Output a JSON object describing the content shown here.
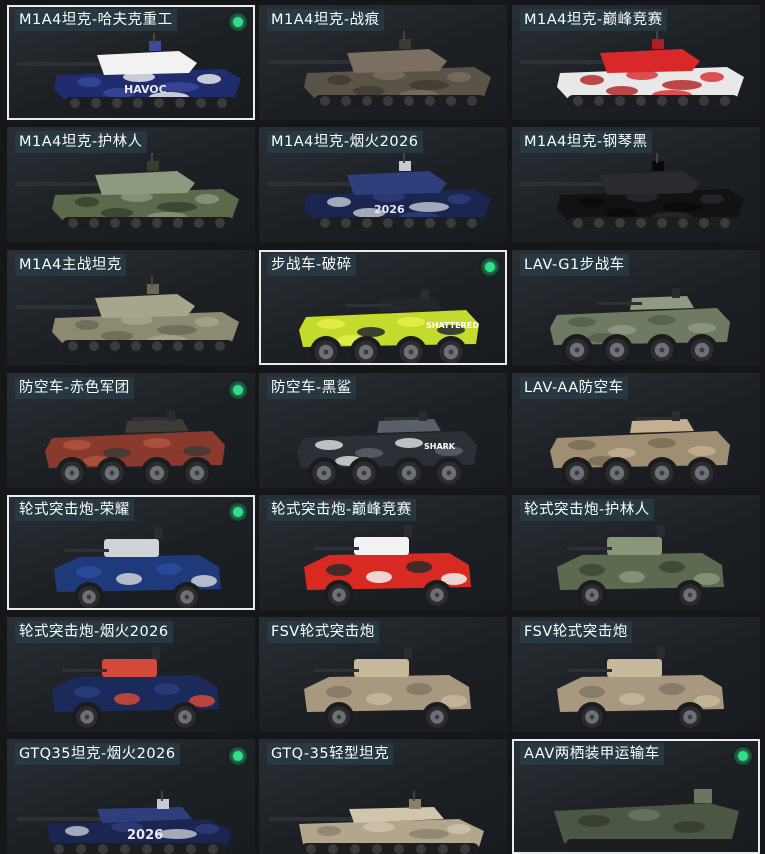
{
  "vehicles": [
    {
      "name": "M1A4坦克-哈夫克重工",
      "type": "tank",
      "colors": [
        "#1f2c6e",
        "#f2f2f2",
        "#3a4a9c"
      ],
      "equipped": true,
      "selected": true,
      "decal": "HAVOC"
    },
    {
      "name": "M1A4坦克-战痕",
      "type": "tank",
      "colors": [
        "#5a5448",
        "#7a6f60",
        "#3d3a33"
      ],
      "equipped": false,
      "selected": false,
      "decal": ""
    },
    {
      "name": "M1A4坦克-巅峰竞赛",
      "type": "tank",
      "colors": [
        "#e8e8e8",
        "#d8282a",
        "#b01e20"
      ],
      "equipped": false,
      "selected": false,
      "decal": ""
    },
    {
      "name": "M1A4坦克-护林人",
      "type": "tank",
      "colors": [
        "#5c6a4c",
        "#8d9a80",
        "#34402c"
      ],
      "equipped": false,
      "selected": false,
      "decal": ""
    },
    {
      "name": "M1A4坦克-烟火2026",
      "type": "tank",
      "colors": [
        "#1a2650",
        "#2e3f7c",
        "#c7c9d6"
      ],
      "equipped": false,
      "selected": false,
      "decal": "2026"
    },
    {
      "name": "M1A4坦克-钢琴黑",
      "type": "tank",
      "colors": [
        "#111214",
        "#2a2b2e",
        "#0a0a0b"
      ],
      "equipped": false,
      "selected": false,
      "decal": ""
    },
    {
      "name": "M1A4主战坦克",
      "type": "tank",
      "colors": [
        "#8d8a72",
        "#a7a58c",
        "#6a6854"
      ],
      "equipped": false,
      "selected": false,
      "decal": ""
    },
    {
      "name": "步战车-破碎",
      "type": "ifv",
      "colors": [
        "#c4da2c",
        "#23262a",
        "#e6f04a"
      ],
      "equipped": true,
      "selected": true,
      "decal": "SHATTERED"
    },
    {
      "name": "LAV-G1步战车",
      "type": "ifv",
      "colors": [
        "#6f7a62",
        "#8f9a80",
        "#55604a"
      ],
      "equipped": false,
      "selected": false,
      "decal": ""
    },
    {
      "name": "防空车-赤色军团",
      "type": "aa",
      "colors": [
        "#8a3a2c",
        "#3e3a36",
        "#b05440"
      ],
      "equipped": true,
      "selected": false,
      "decal": ""
    },
    {
      "name": "防空车-黑鲨",
      "type": "aa",
      "colors": [
        "#2c3036",
        "#5a6068",
        "#d8dadc"
      ],
      "equipped": false,
      "selected": false,
      "decal": "SHARK"
    },
    {
      "name": "LAV-AA防空车",
      "type": "aa",
      "colors": [
        "#a08e72",
        "#c2b090",
        "#7a6c56"
      ],
      "equipped": false,
      "selected": false,
      "decal": ""
    },
    {
      "name": "轮式突击炮-荣耀",
      "type": "apc",
      "colors": [
        "#1e3a7a",
        "#cfd3d8",
        "#2a4c9c"
      ],
      "equipped": true,
      "selected": true,
      "decal": ""
    },
    {
      "name": "轮式突击炮-巅峰竞赛",
      "type": "apc",
      "colors": [
        "#d82a22",
        "#f2f2f2",
        "#2a2a2a"
      ],
      "equipped": false,
      "selected": false,
      "decal": ""
    },
    {
      "name": "轮式突击炮-护林人",
      "type": "apc",
      "colors": [
        "#5e6a50",
        "#8a967a",
        "#3c4634"
      ],
      "equipped": false,
      "selected": false,
      "decal": ""
    },
    {
      "name": "轮式突击炮-烟火2026",
      "type": "apc",
      "colors": [
        "#1a2a5a",
        "#d44a3a",
        "#2a3c7c"
      ],
      "equipped": false,
      "selected": false,
      "decal": ""
    },
    {
      "name": "FSV轮式突击炮",
      "type": "apc",
      "colors": [
        "#a89880",
        "#c8b89c",
        "#847660"
      ],
      "equipped": false,
      "selected": false,
      "decal": ""
    },
    {
      "name": "FSV轮式突击炮",
      "type": "apc",
      "colors": [
        "#a89880",
        "#c8b89c",
        "#847660"
      ],
      "equipped": false,
      "selected": false,
      "decal": ""
    },
    {
      "name": "GTQ35坦克-烟火2026",
      "type": "light",
      "colors": [
        "#1a2650",
        "#2e3f7c",
        "#c7c9d6"
      ],
      "equipped": true,
      "selected": false,
      "decal": "2026"
    },
    {
      "name": "GTQ-35轻型坦克",
      "type": "light",
      "colors": [
        "#b2a68c",
        "#d0c6ac",
        "#8a806a"
      ],
      "equipped": false,
      "selected": false,
      "decal": ""
    },
    {
      "name": "AAV两栖装甲运输车",
      "type": "aav",
      "colors": [
        "#4c5644",
        "#6a7660",
        "#343c2e"
      ],
      "equipped": true,
      "selected": true,
      "decal": ""
    }
  ]
}
